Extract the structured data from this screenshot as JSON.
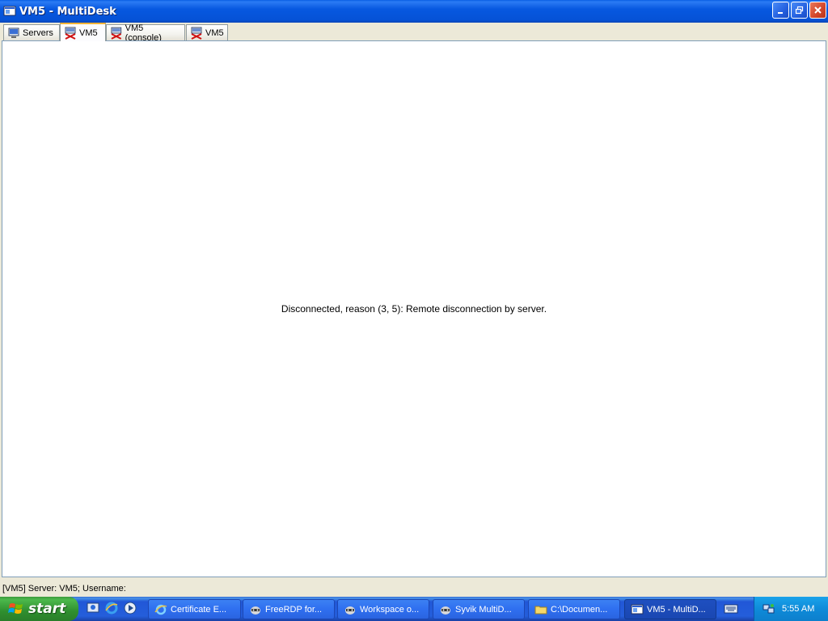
{
  "window": {
    "title": "VM5 - MultiDesk"
  },
  "tabs": [
    {
      "label": "Servers",
      "icon": "servers-icon",
      "active": false
    },
    {
      "label": "VM5",
      "icon": "disconnected-server-icon",
      "active": true
    },
    {
      "label": "VM5 (console)",
      "icon": "disconnected-server-icon",
      "active": false
    },
    {
      "label": "VM5",
      "icon": "disconnected-server-icon",
      "active": false
    }
  ],
  "content": {
    "message": "Disconnected, reason (3, 5): Remote disconnection by server."
  },
  "statusbar": {
    "text": "[VM5] Server: VM5; Username:"
  },
  "taskbar": {
    "start_label": "start",
    "quick_launch": [
      "show-desktop-icon",
      "internet-explorer-icon",
      "media-player-icon"
    ],
    "tasks": [
      {
        "label": "Certificate E...",
        "icon": "internet-explorer-icon"
      },
      {
        "label": "FreeRDP for...",
        "icon": "raccoon-icon"
      },
      {
        "label": "Workspace o...",
        "icon": "raccoon-icon"
      },
      {
        "label": "Syvik MultiD...",
        "icon": "raccoon-icon"
      },
      {
        "label": "C:\\Documen...",
        "icon": "folder-icon"
      },
      {
        "label": "VM5 - MultiD...",
        "icon": "multidesk-icon"
      }
    ],
    "clock": "5:55 AM"
  },
  "colors": {
    "titlebar": "#0758e0",
    "taskbar": "#245edb",
    "start": "#2f8f2f",
    "tray": "#0f8bd9",
    "active_tab_accent": "#f7b336"
  }
}
